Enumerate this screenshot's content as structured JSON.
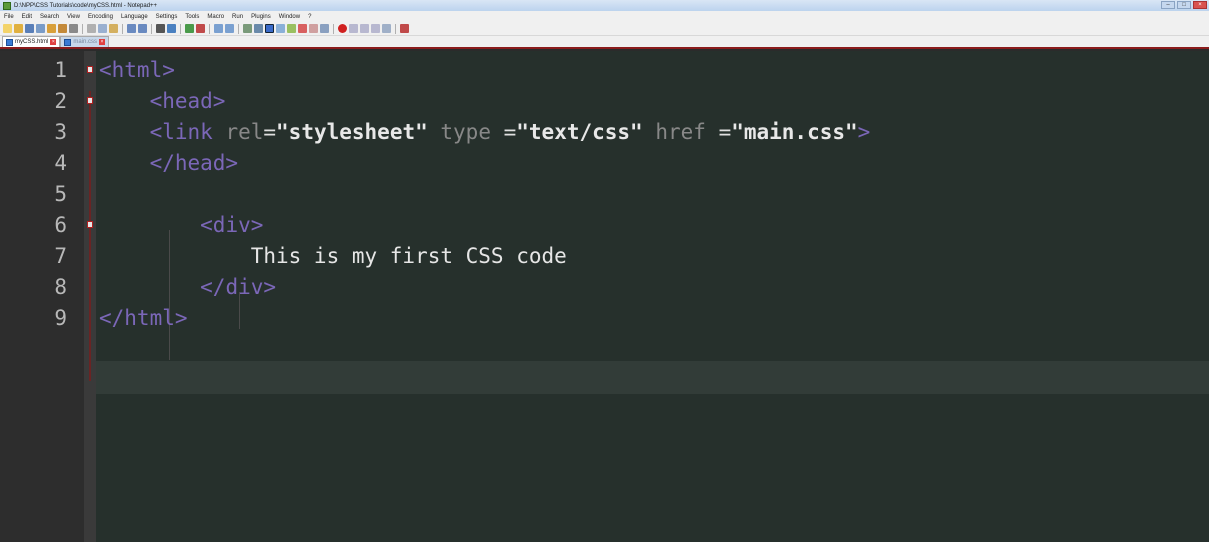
{
  "window": {
    "title": "D:\\NPP\\CSS Tutorials\\code\\myCSS.html - Notepad++",
    "controls": [
      "minimize",
      "maximize",
      "close"
    ]
  },
  "menu": [
    "File",
    "Edit",
    "Search",
    "View",
    "Encoding",
    "Language",
    "Settings",
    "Tools",
    "Macro",
    "Run",
    "Plugins",
    "Window",
    "?"
  ],
  "tabs": [
    {
      "label": "myCSS.html",
      "active": true
    },
    {
      "label": "main.css",
      "active": false
    }
  ],
  "editor": {
    "current_line": 9,
    "lines": [
      {
        "number": "1",
        "fold": true,
        "tokens": [
          {
            "t": "tag",
            "v": "<html>"
          }
        ]
      },
      {
        "number": "2",
        "fold": true,
        "tokens": [
          {
            "t": "ws",
            "v": "    "
          },
          {
            "t": "tag",
            "v": "<head>"
          }
        ]
      },
      {
        "number": "3",
        "fold": false,
        "tokens": [
          {
            "t": "ws",
            "v": "    "
          },
          {
            "t": "tag",
            "v": "<link "
          },
          {
            "t": "attr",
            "v": "rel"
          },
          {
            "t": "op",
            "v": "="
          },
          {
            "t": "str",
            "v": "\"stylesheet\""
          },
          {
            "t": "attr",
            "v": " type "
          },
          {
            "t": "op",
            "v": "="
          },
          {
            "t": "str",
            "v": "\"text/css\""
          },
          {
            "t": "attr",
            "v": " href "
          },
          {
            "t": "op",
            "v": "="
          },
          {
            "t": "str",
            "v": "\"main.css\""
          },
          {
            "t": "tag",
            "v": ">"
          }
        ]
      },
      {
        "number": "4",
        "fold": false,
        "tokens": [
          {
            "t": "ws",
            "v": "    "
          },
          {
            "t": "tag",
            "v": "</head>"
          }
        ]
      },
      {
        "number": "5",
        "fold": false,
        "tokens": []
      },
      {
        "number": "6",
        "fold": true,
        "tokens": [
          {
            "t": "ws",
            "v": "        "
          },
          {
            "t": "tag",
            "v": "<div>"
          }
        ]
      },
      {
        "number": "7",
        "fold": false,
        "tokens": [
          {
            "t": "ws",
            "v": "            "
          },
          {
            "t": "text",
            "v": "This is my first CSS code"
          }
        ]
      },
      {
        "number": "8",
        "fold": false,
        "tokens": [
          {
            "t": "ws",
            "v": "        "
          },
          {
            "t": "tag",
            "v": "</div>"
          }
        ]
      },
      {
        "number": "9",
        "fold": false,
        "tokens": [
          {
            "t": "tag",
            "v": "</html>"
          }
        ]
      }
    ]
  },
  "colors": {
    "editor_bg": "#26302c",
    "tag": "#7b67b8",
    "attribute": "#888888",
    "string": "#e8e8e8",
    "fold_marker_border": "#b02020"
  }
}
